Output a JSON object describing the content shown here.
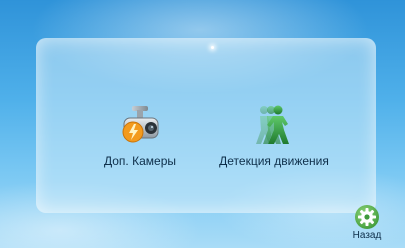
{
  "menu": {
    "items": [
      {
        "label": "Доп. Камеры",
        "icon": "security-camera-icon"
      },
      {
        "label": "Детекция движения",
        "icon": "motion-detection-icon"
      }
    ]
  },
  "back": {
    "label": "Назад",
    "icon": "gear-icon"
  },
  "colors": {
    "background_top": "#2f93d9",
    "background_bottom": "#a9dcf7",
    "text": "#0e2f4a",
    "accent_orange": "#f39a1d",
    "accent_green": "#3aa845"
  }
}
